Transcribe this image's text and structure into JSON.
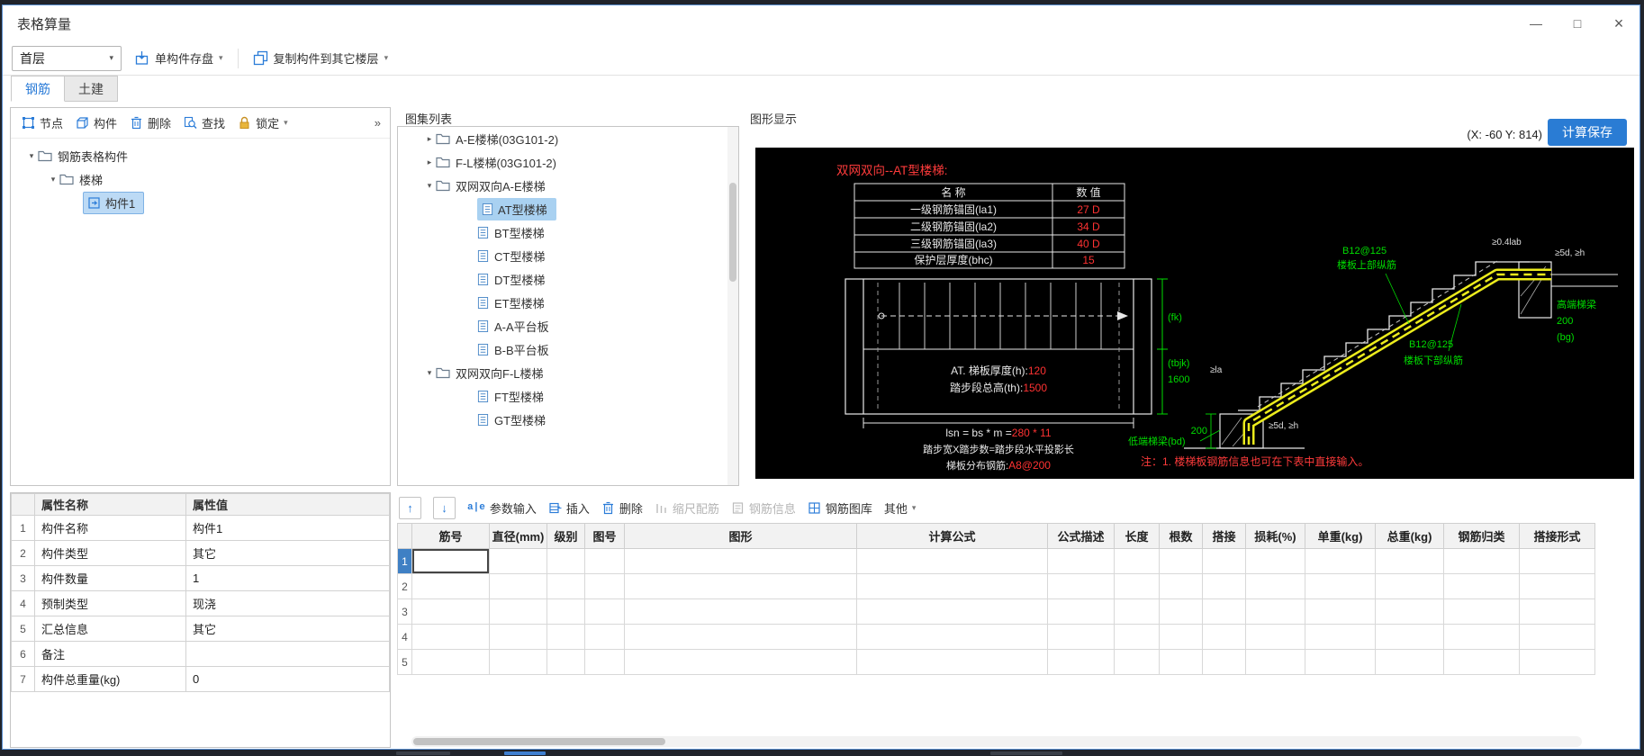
{
  "window": {
    "title": "表格算量"
  },
  "icons": {
    "minimize": "—",
    "maximize": "□",
    "close": "×",
    "caret": "▾",
    "collapsed": "▸",
    "expanded": "▾",
    "more": "»",
    "up": "↑",
    "down": "↓"
  },
  "toolbar": {
    "floor": "首层",
    "save_single": "单构件存盘",
    "copy_to_floors": "复制构件到其它楼层"
  },
  "tabs": {
    "rebar": "钢筋",
    "civil": "土建"
  },
  "component_panel": {
    "toolbar": {
      "node": "节点",
      "component": "构件",
      "delete": "删除",
      "find": "查找",
      "lock": "锁定"
    },
    "tree": {
      "root": "钢筋表格构件",
      "folder": "楼梯",
      "item": "构件1"
    }
  },
  "atlas_panel": {
    "title": "图集列表",
    "items": [
      {
        "label": "A-E楼梯(03G101-2)"
      },
      {
        "label": "F-L楼梯(03G101-2)"
      },
      {
        "label": "双网双向A-E楼梯"
      },
      {
        "label": "AT型楼梯"
      },
      {
        "label": "BT型楼梯"
      },
      {
        "label": "CT型楼梯"
      },
      {
        "label": "DT型楼梯"
      },
      {
        "label": "ET型楼梯"
      },
      {
        "label": "A-A平台板"
      },
      {
        "label": "B-B平台板"
      },
      {
        "label": "双网双向F-L楼梯"
      },
      {
        "label": "FT型楼梯"
      },
      {
        "label": "GT型楼梯"
      }
    ]
  },
  "graphic_panel": {
    "title": "图形显示",
    "coords": "(X: -60 Y: 814)",
    "calc_save_button": "计算保存"
  },
  "cad": {
    "title": "双网双向--AT型楼梯:",
    "param_table": {
      "header_name": "名  称",
      "header_value": "数  值",
      "rows": [
        {
          "name": "一级钢筋锚固(la1)",
          "value": "27 D"
        },
        {
          "name": "二级钢筋锚固(la2)",
          "value": "34 D"
        },
        {
          "name": "三级钢筋锚固(la3)",
          "value": "40 D"
        },
        {
          "name": "保护层厚度(bhc)",
          "value": "15"
        }
      ]
    },
    "plan": {
      "thickness_label": "AT. 梯板厚度(h):",
      "thickness_value": "120",
      "height_label": "踏步段总高(th):",
      "height_value": "1500",
      "dim_fk": "(fk)",
      "dim_tbjk": "(tbjk)",
      "dim_1600": "1600",
      "formula_label": "lsn = bs * m =",
      "formula_value": "280 * 11",
      "caption_width": "踏步宽X踏步数=踏步段水平投影长",
      "caption_dist_label": "梯板分布钢筋:",
      "caption_dist_value": "A8@200"
    },
    "section": {
      "top_rebar_spec": "B12@125",
      "top_rebar_name": "楼板上部纵筋",
      "bottom_rebar_spec": "B12@125",
      "bottom_rebar_name": "楼板下部纵筋",
      "high_beam_label": "高端梯梁",
      "low_beam_label": "低端梯梁(bd)",
      "dim_high_200": "200",
      "dim_bg": "(bg)",
      "dim_low_200": "200",
      "anchor_top_1": "≥0.4lab",
      "anchor_top_2": "≥5d, ≥h",
      "anchor_low_1": "≥la",
      "anchor_low_2": "≥5d, ≥h"
    },
    "note": "注：1. 楼梯板钢筋信息也可在下表中直接输入。"
  },
  "properties_panel": {
    "headers": {
      "name": "属性名称",
      "value": "属性值"
    },
    "rows": [
      {
        "no": "1",
        "name": "构件名称",
        "value": "构件1"
      },
      {
        "no": "2",
        "name": "构件类型",
        "value": "其它"
      },
      {
        "no": "3",
        "name": "构件数量",
        "value": "1"
      },
      {
        "no": "4",
        "name": "预制类型",
        "value": "现浇"
      },
      {
        "no": "5",
        "name": "汇总信息",
        "value": "其它"
      },
      {
        "no": "6",
        "name": "备注",
        "value": ""
      },
      {
        "no": "7",
        "name": "构件总重量(kg)",
        "value": "0"
      }
    ]
  },
  "rebar_toolbar": {
    "param_input": "参数输入",
    "insert": "插入",
    "delete": "删除",
    "scale_rebar": "缩尺配筋",
    "rebar_info": "钢筋信息",
    "rebar_gallery": "钢筋图库",
    "other": "其他"
  },
  "rebar_table": {
    "headers": [
      "筋号",
      "直径(mm)",
      "级别",
      "图号",
      "图形",
      "计算公式",
      "公式描述",
      "长度",
      "根数",
      "搭接",
      "损耗(%)",
      "单重(kg)",
      "总重(kg)",
      "钢筋归类",
      "搭接形式"
    ],
    "row_numbers": [
      "1",
      "2",
      "3",
      "4",
      "5"
    ]
  }
}
